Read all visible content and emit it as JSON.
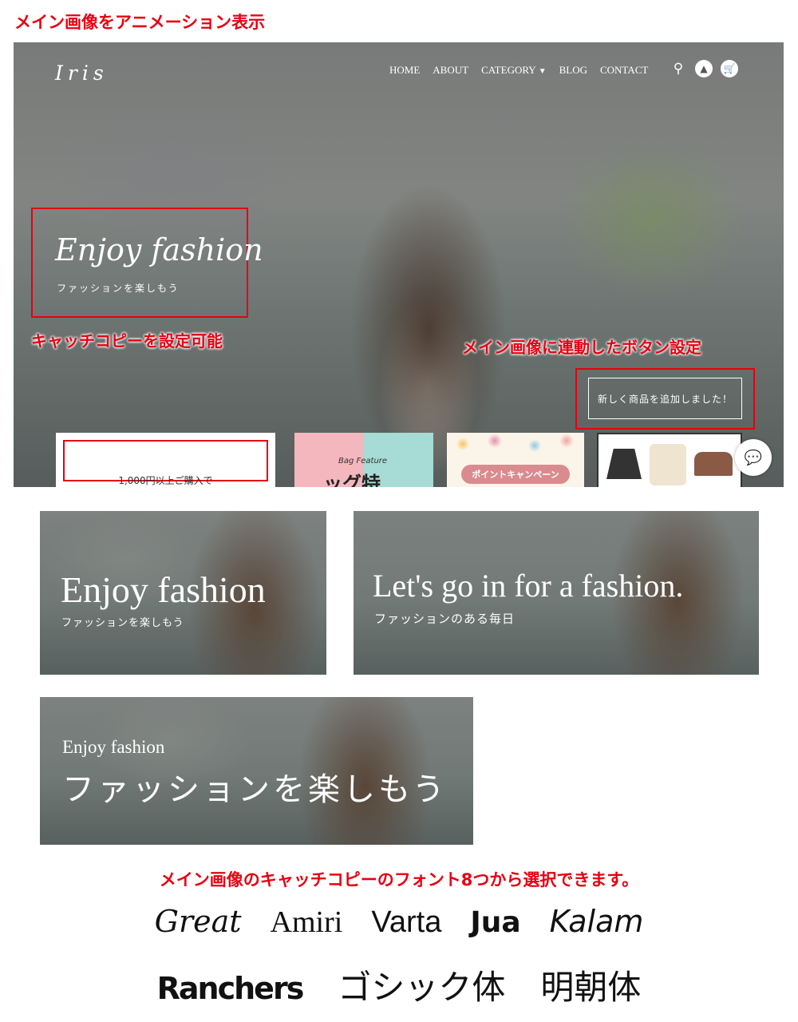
{
  "top_title": "メイン画像をアニメーション表示",
  "hero": {
    "logo": "Iris",
    "nav": {
      "home": "HOME",
      "about": "ABOUT",
      "category": "CATEGORY",
      "blog": "BLOG",
      "contact": "CONTACT"
    },
    "catch_copy": "Enjoy fashion",
    "catch_sub": "ファッションを楽しもう",
    "annotation_catch": "キャッチコピーを設定可能",
    "annotation_button": "メイン画像に連動したボタン設定",
    "button_label": "新しく商品を追加しました！",
    "cards": {
      "card1_text": "1,000円以上ご購入で",
      "card2_script": "Bag Feature",
      "card2_big": "ッグ特",
      "card3_pill": "ポイントキャンペーン"
    }
  },
  "banners": [
    {
      "main": "Enjoy fashion",
      "sub": "ファッションを楽しもう"
    },
    {
      "main": "Let's go in for a fashion.",
      "sub": "ファッションのある毎日"
    },
    {
      "main": "Enjoy fashion",
      "sub": "ファッションを楽しもう"
    }
  ],
  "fonts": {
    "title": "メイン画像のキャッチコピーのフォント8つから選択できます。",
    "row1": [
      "Great",
      "Amiri",
      "Varta",
      "Jua",
      "Kalam"
    ],
    "row2": [
      "Ranchers",
      "ゴシック体",
      "明朝体"
    ]
  },
  "colors": {
    "accent_red": "#e60012"
  }
}
